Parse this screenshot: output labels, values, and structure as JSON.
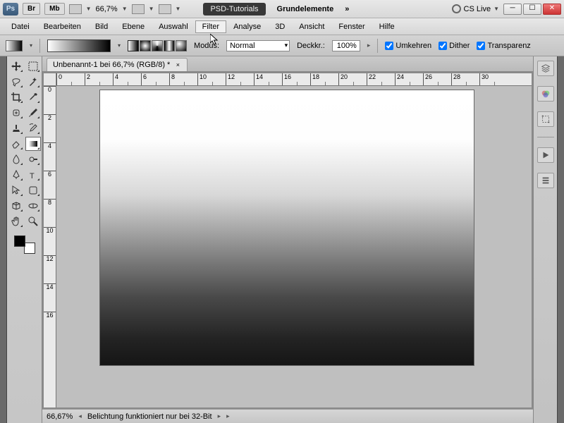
{
  "title": {
    "zoom": "66,7%",
    "tab_psd_tutorials": "PSD-Tutorials",
    "tab_grundelemente": "Grundelemente",
    "cslive": "CS Live",
    "br": "Br",
    "mb": "Mb"
  },
  "menu": {
    "datei": "Datei",
    "bearbeiten": "Bearbeiten",
    "bild": "Bild",
    "ebene": "Ebene",
    "auswahl": "Auswahl",
    "filter": "Filter",
    "analyse": "Analyse",
    "dreid": "3D",
    "ansicht": "Ansicht",
    "fenster": "Fenster",
    "hilfe": "Hilfe"
  },
  "options": {
    "modus_label": "Modus:",
    "modus_value": "Normal",
    "deckkr_label": "Deckkr.:",
    "deckkr_value": "100%",
    "umkehren": "Umkehren",
    "dither": "Dither",
    "transparenz": "Transparenz"
  },
  "document": {
    "tab_title": "Unbenannt-1 bei 66,7% (RGB/8) *"
  },
  "ruler_h": [
    "0",
    "2",
    "4",
    "6",
    "8",
    "10",
    "12",
    "14",
    "16",
    "18",
    "20",
    "22",
    "24",
    "26",
    "28",
    "30"
  ],
  "ruler_v": [
    "0",
    "2",
    "4",
    "6",
    "8",
    "10",
    "12",
    "14",
    "16"
  ],
  "status": {
    "zoom": "66,67%",
    "msg": "Belichtung funktioniert nur bei 32-Bit"
  },
  "colors": {
    "canvas_bg": "#bfbfbf"
  }
}
